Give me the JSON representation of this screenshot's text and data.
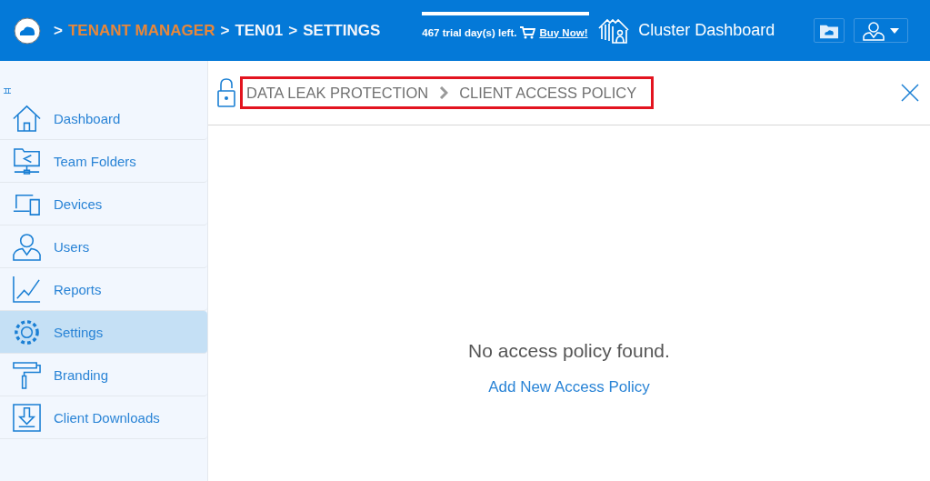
{
  "header": {
    "breadcrumb": [
      {
        "label": ">",
        "kind": "sep"
      },
      {
        "label": "TENANT MANAGER",
        "kind": "link"
      },
      {
        "label": ">",
        "kind": "sep"
      },
      {
        "label": "TEN01",
        "kind": "current"
      },
      {
        "label": ">",
        "kind": "sep"
      },
      {
        "label": "SETTINGS",
        "kind": "current"
      }
    ],
    "trial": {
      "text": "467 trial day(s) left.",
      "buy": "Buy Now!"
    },
    "cluster": "Cluster Dashboard"
  },
  "sidebar": {
    "items": [
      {
        "label": "Dashboard",
        "selected": false
      },
      {
        "label": "Team Folders",
        "selected": false
      },
      {
        "label": "Devices",
        "selected": false
      },
      {
        "label": "Users",
        "selected": false
      },
      {
        "label": "Reports",
        "selected": false
      },
      {
        "label": "Settings",
        "selected": true
      },
      {
        "label": "Branding",
        "selected": false
      },
      {
        "label": "Client Downloads",
        "selected": false
      }
    ]
  },
  "panel": {
    "path": [
      "DATA LEAK PROTECTION",
      "CLIENT ACCESS POLICY"
    ],
    "empty_message": "No access policy found.",
    "add_link": "Add New Access Policy"
  }
}
